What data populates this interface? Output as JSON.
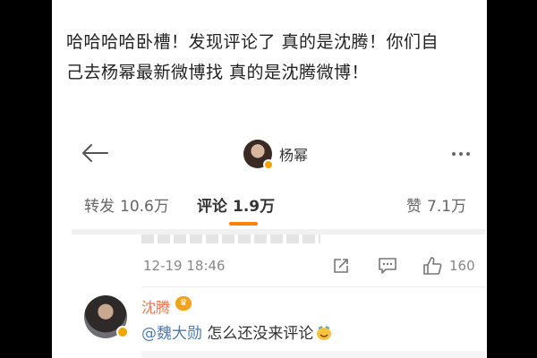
{
  "post": {
    "line1": "哈哈哈哈卧槽！发现评论了 真的是沈腾！你们自",
    "line2": "己去杨幂最新微博找 真的是沈腾微博！"
  },
  "embed": {
    "header": {
      "profile_name": "杨幂",
      "back_icon": "arrow-left-icon",
      "more_icon": "more-dots-icon"
    },
    "tabs": [
      {
        "label": "转发",
        "count": "10.6万"
      },
      {
        "label": "评论",
        "count": "1.9万",
        "active": true
      },
      {
        "label": "赞",
        "count": "7.1万"
      }
    ],
    "meta": {
      "time": "12-19 18:46",
      "like_count": "160"
    },
    "comment": {
      "author": "沈腾",
      "mention": "@魏大勋",
      "text": " 怎么还没来评论",
      "vip_badge": "♛"
    }
  },
  "colors": {
    "accent": "#ff8200",
    "author": "#eb7350",
    "mention": "#507daf",
    "background": "#000000"
  }
}
